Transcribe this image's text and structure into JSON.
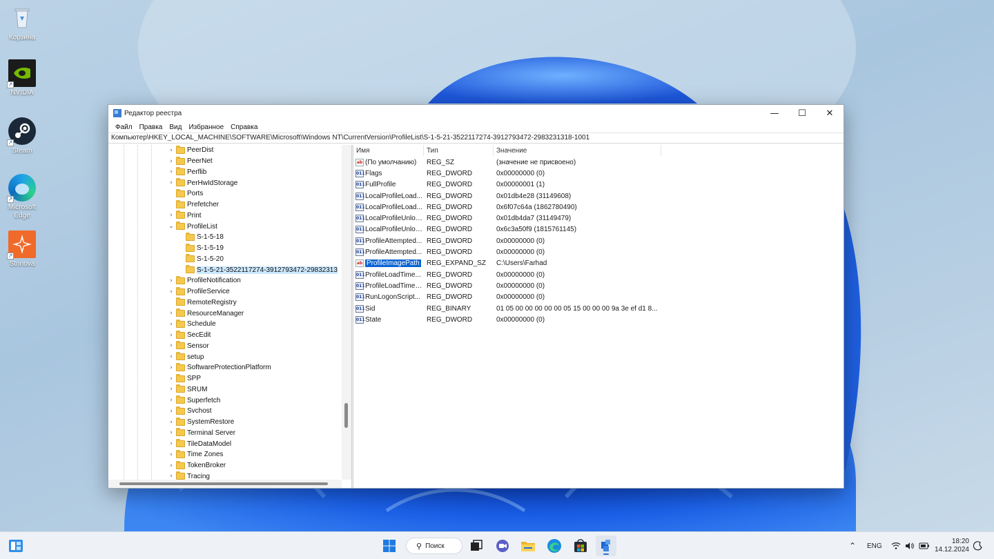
{
  "desktop": {
    "icons": [
      {
        "label": "Корзина",
        "icon": "recycle-bin-icon"
      },
      {
        "label": "NVIDIA",
        "icon": "nvidia-icon"
      },
      {
        "label": "Steam",
        "icon": "steam-icon"
      },
      {
        "label": "Microsoft Edge",
        "icon": "edge-icon"
      },
      {
        "label": "Strinova",
        "icon": "strinova-icon"
      }
    ]
  },
  "window": {
    "title": "Редактор реестра",
    "controls": {
      "minimize": "—",
      "maximize": "☐",
      "close": "✕"
    },
    "menu": [
      "Файл",
      "Правка",
      "Вид",
      "Избранное",
      "Справка"
    ],
    "address": "Компьютер\\HKEY_LOCAL_MACHINE\\SOFTWARE\\Microsoft\\Windows NT\\CurrentVersion\\ProfileList\\S-1-5-21-3522117274-3912793472-2983231318-1001",
    "tree": [
      {
        "label": "PeerDist",
        "level": 0,
        "expander": "›"
      },
      {
        "label": "PeerNet",
        "level": 0,
        "expander": "›"
      },
      {
        "label": "Perflib",
        "level": 0,
        "expander": "›"
      },
      {
        "label": "PerHwIdStorage",
        "level": 0,
        "expander": "›"
      },
      {
        "label": "Ports",
        "level": 0,
        "expander": ""
      },
      {
        "label": "Prefetcher",
        "level": 0,
        "expander": ""
      },
      {
        "label": "Print",
        "level": 0,
        "expander": "›"
      },
      {
        "label": "ProfileList",
        "level": 0,
        "expander": "⌄"
      },
      {
        "label": "S-1-5-18",
        "level": 1,
        "expander": ""
      },
      {
        "label": "S-1-5-19",
        "level": 1,
        "expander": ""
      },
      {
        "label": "S-1-5-20",
        "level": 1,
        "expander": ""
      },
      {
        "label": "S-1-5-21-3522117274-3912793472-29832313",
        "level": 1,
        "expander": "",
        "selected": true
      },
      {
        "label": "ProfileNotification",
        "level": 0,
        "expander": "›"
      },
      {
        "label": "ProfileService",
        "level": 0,
        "expander": "›"
      },
      {
        "label": "RemoteRegistry",
        "level": 0,
        "expander": ""
      },
      {
        "label": "ResourceManager",
        "level": 0,
        "expander": "›"
      },
      {
        "label": "Schedule",
        "level": 0,
        "expander": "›"
      },
      {
        "label": "SecEdit",
        "level": 0,
        "expander": "›"
      },
      {
        "label": "Sensor",
        "level": 0,
        "expander": "›"
      },
      {
        "label": "setup",
        "level": 0,
        "expander": "›"
      },
      {
        "label": "SoftwareProtectionPlatform",
        "level": 0,
        "expander": "›"
      },
      {
        "label": "SPP",
        "level": 0,
        "expander": "›"
      },
      {
        "label": "SRUM",
        "level": 0,
        "expander": "›"
      },
      {
        "label": "Superfetch",
        "level": 0,
        "expander": "›"
      },
      {
        "label": "Svchost",
        "level": 0,
        "expander": "›"
      },
      {
        "label": "SystemRestore",
        "level": 0,
        "expander": "›"
      },
      {
        "label": "Terminal Server",
        "level": 0,
        "expander": "›"
      },
      {
        "label": "TileDataModel",
        "level": 0,
        "expander": "›"
      },
      {
        "label": "Time Zones",
        "level": 0,
        "expander": "›"
      },
      {
        "label": "TokenBroker",
        "level": 0,
        "expander": "›"
      },
      {
        "label": "Tracing",
        "level": 0,
        "expander": "›"
      }
    ],
    "columns": {
      "name": "Имя",
      "type": "Тип",
      "value": "Значение"
    },
    "values": [
      {
        "name": "(По умолчанию)",
        "type": "REG_SZ",
        "value": "(значение не присвоено)",
        "kind": "sz"
      },
      {
        "name": "Flags",
        "type": "REG_DWORD",
        "value": "0x00000000 (0)",
        "kind": "bin"
      },
      {
        "name": "FullProfile",
        "type": "REG_DWORD",
        "value": "0x00000001 (1)",
        "kind": "bin"
      },
      {
        "name": "LocalProfileLoad...",
        "type": "REG_DWORD",
        "value": "0x01db4e28 (31149608)",
        "kind": "bin"
      },
      {
        "name": "LocalProfileLoad...",
        "type": "REG_DWORD",
        "value": "0x6f07c64a (1862780490)",
        "kind": "bin"
      },
      {
        "name": "LocalProfileUnloa...",
        "type": "REG_DWORD",
        "value": "0x01db4da7 (31149479)",
        "kind": "bin"
      },
      {
        "name": "LocalProfileUnloa...",
        "type": "REG_DWORD",
        "value": "0x6c3a50f9 (1815761145)",
        "kind": "bin"
      },
      {
        "name": "ProfileAttempted...",
        "type": "REG_DWORD",
        "value": "0x00000000 (0)",
        "kind": "bin"
      },
      {
        "name": "ProfileAttempted...",
        "type": "REG_DWORD",
        "value": "0x00000000 (0)",
        "kind": "bin"
      },
      {
        "name": "ProfileImagePath",
        "type": "REG_EXPAND_SZ",
        "value": "C:\\Users\\Farhad",
        "kind": "sz",
        "selected": true
      },
      {
        "name": "ProfileLoadTime...",
        "type": "REG_DWORD",
        "value": "0x00000000 (0)",
        "kind": "bin"
      },
      {
        "name": "ProfileLoadTimeL...",
        "type": "REG_DWORD",
        "value": "0x00000000 (0)",
        "kind": "bin"
      },
      {
        "name": "RunLogonScript...",
        "type": "REG_DWORD",
        "value": "0x00000000 (0)",
        "kind": "bin"
      },
      {
        "name": "Sid",
        "type": "REG_BINARY",
        "value": "01 05 00 00 00 00 00 05 15 00 00 00 9a 3e ef d1 8...",
        "kind": "bin"
      },
      {
        "name": "State",
        "type": "REG_DWORD",
        "value": "0x00000000 (0)",
        "kind": "bin"
      }
    ]
  },
  "taskbar": {
    "search_label": "Поиск",
    "language": "ENG",
    "time": "18:20",
    "date": "14.12.2024",
    "apps": [
      "start-icon",
      "search-icon",
      "task-view-icon",
      "chat-icon",
      "file-explorer-icon",
      "edge-icon",
      "store-icon",
      "regedit-icon"
    ]
  }
}
